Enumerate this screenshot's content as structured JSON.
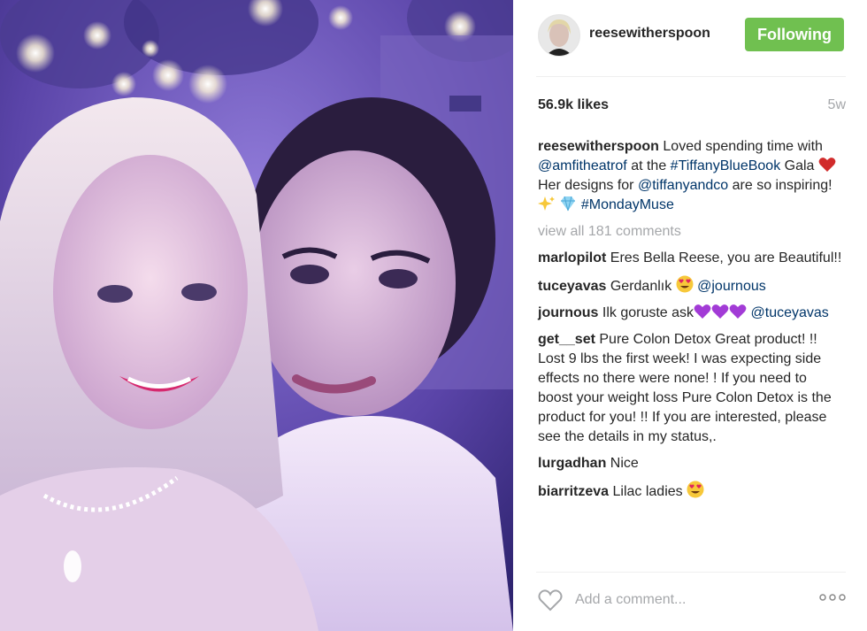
{
  "post": {
    "username": "reesewitherspoon",
    "follow_button_label": "Following",
    "likes": "56.9k likes",
    "time_ago": "5w",
    "caption": {
      "user": "reesewitherspoon",
      "t1": "Loved spending time with",
      "m1": "@amfitheatrof",
      "t2": "at the",
      "h1": "#TiffanyBlueBook",
      "t3": "Gala",
      "t4": "Her designs for",
      "m2": "@tiffanyandco",
      "t5": "are so inspiring!",
      "h2": "#MondayMuse"
    },
    "view_all_comments": "view all 181 comments",
    "comments": [
      {
        "user": "marlopilot",
        "text": "Eres Bella Reese, you are Beautiful!!"
      },
      {
        "user": "tuceyavas",
        "text": "Gerdanlık",
        "mention": "@journous"
      },
      {
        "user": "journous",
        "text": "Ilk goruste ask",
        "mention": "@tuceyavas"
      },
      {
        "user": "get__set",
        "text": "Pure Colon Detox Great product! !! Lost 9 lbs the first week! I was expecting side effects no there were none! ! If you need to boost your weight loss Pure Colon Detox is the product for you! !! If you are interested, please see the details in my status,."
      },
      {
        "user": "lurgadhan",
        "text": "Nice"
      },
      {
        "user": "biarritzeva",
        "text": "Lilac ladies"
      }
    ],
    "add_comment_placeholder": "Add a comment...",
    "icons": [
      "heart-outline-icon",
      "more-options-icon",
      "red-heart-emoji",
      "sparkles-emoji",
      "gem-emoji",
      "heart-eyes-emoji",
      "purple-heart-emoji"
    ],
    "colors": {
      "follow_button": "#70c050",
      "link": "#003569",
      "muted": "#a5a7aa"
    }
  }
}
